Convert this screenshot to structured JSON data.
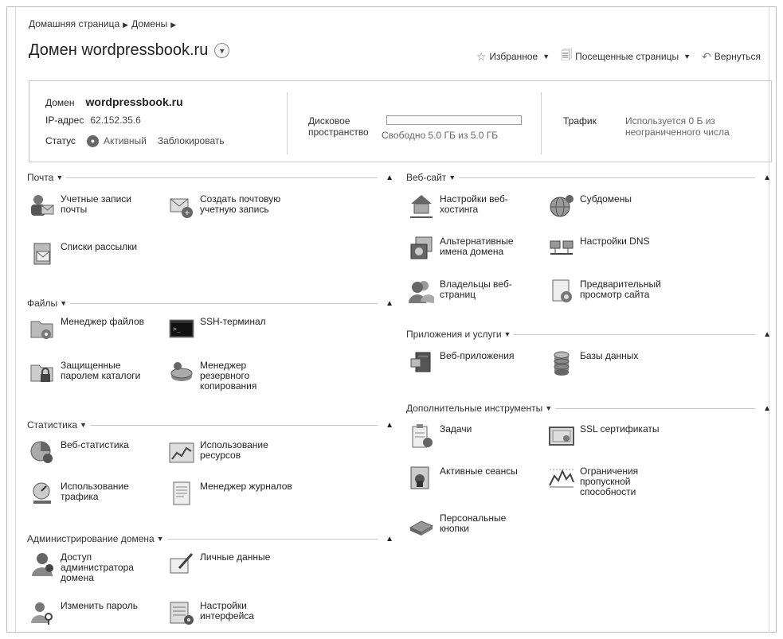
{
  "breadcrumb": [
    "Домашняя страница",
    "Домены"
  ],
  "page_title": "Домен wordpressbook.ru",
  "toplinks": {
    "favorites": "Избранное",
    "visited": "Посещенные страницы",
    "back": "Вернуться"
  },
  "info": {
    "domain_label": "Домен",
    "domain_value": "wordpressbook.ru",
    "ip_label": "IP-адрес",
    "ip_value": "62.152.35.6",
    "status_label": "Статус",
    "status_value": "Активный",
    "block_link": "Заблокировать",
    "disk_label_1": "Дисковое",
    "disk_label_2": "пространство",
    "disk_text": "Свободно 5.0 ГБ из 5.0 ГБ",
    "disk_used_fraction": 0,
    "traffic_label": "Трафик",
    "traffic_value": "Используется 0 Б из неограниченного числа"
  },
  "sections": {
    "mail": {
      "title": "Почта",
      "items": [
        "Учетные записи почты",
        "Создать почтовую учетную запись",
        "Списки рассылки"
      ]
    },
    "files": {
      "title": "Файлы",
      "items": [
        "Менеджер файлов",
        "SSH-терминал",
        "Защищенные паролем каталоги",
        "Менеджер резервного копирования"
      ]
    },
    "stats": {
      "title": "Статистика",
      "items": [
        "Веб-статистика",
        "Использование ресурсов",
        "Использование трафика",
        "Менеджер журналов"
      ]
    },
    "admin": {
      "title": "Администрирование домена",
      "items": [
        "Доступ администратора домена",
        "Личные данные",
        "Изменить пароль",
        "Настройки интерфейса"
      ]
    },
    "website": {
      "title": "Веб-сайт",
      "items": [
        "Настройки веб-хостинга",
        "Субдомены",
        "Альтернативные имена домена",
        "Настройки DNS",
        "Владельцы веб-страниц",
        "Предварительный просмотр сайта"
      ]
    },
    "apps": {
      "title": "Приложения и услуги",
      "items": [
        "Веб-приложения",
        "Базы данных"
      ]
    },
    "tools": {
      "title": "Дополнительные инструменты",
      "items": [
        "Задачи",
        "SSL сертификаты",
        "Активные сеансы",
        "Ограничения пропускной способности",
        "Персональные кнопки"
      ]
    }
  }
}
